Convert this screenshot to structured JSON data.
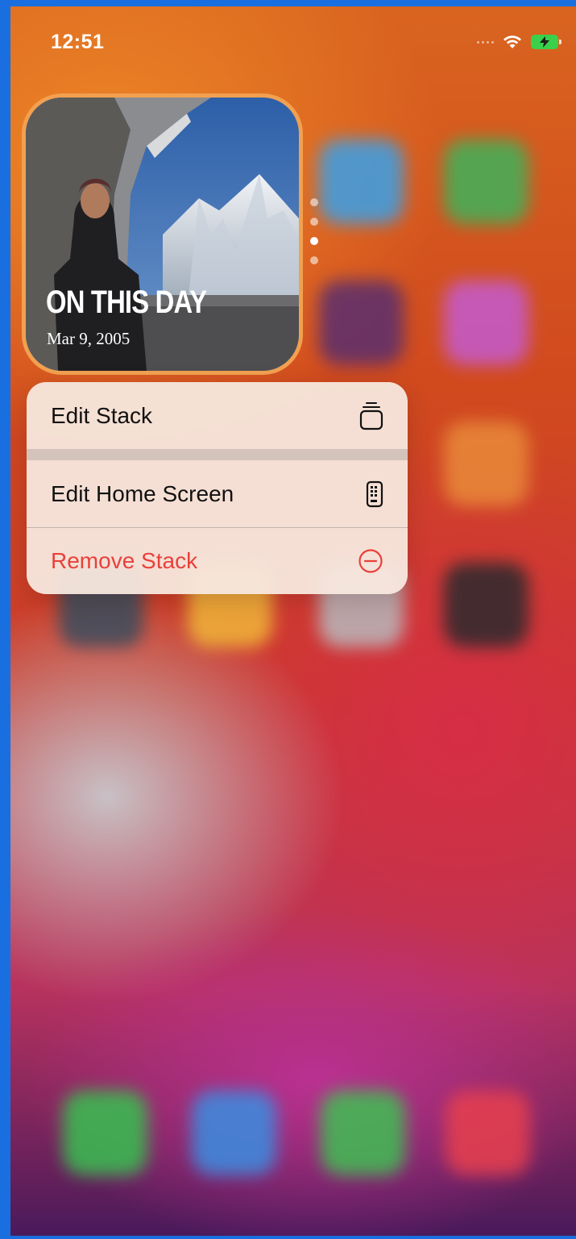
{
  "status_bar": {
    "time": "12:51"
  },
  "widget": {
    "title": "ON THIS DAY",
    "date": "Mar 9, 2005",
    "stack_pages": 4,
    "active_page": 3
  },
  "context_menu": {
    "items": [
      {
        "label": "Edit Stack",
        "icon": "stack-icon"
      },
      {
        "label": "Edit Home Screen",
        "icon": "phone-grid-icon"
      },
      {
        "label": "Remove Stack",
        "icon": "minus-circle-icon",
        "destructive": true
      }
    ]
  },
  "colors": {
    "destructive": "#e8413a",
    "widget_border": "#f2a050",
    "battery": "#3ad04b"
  }
}
